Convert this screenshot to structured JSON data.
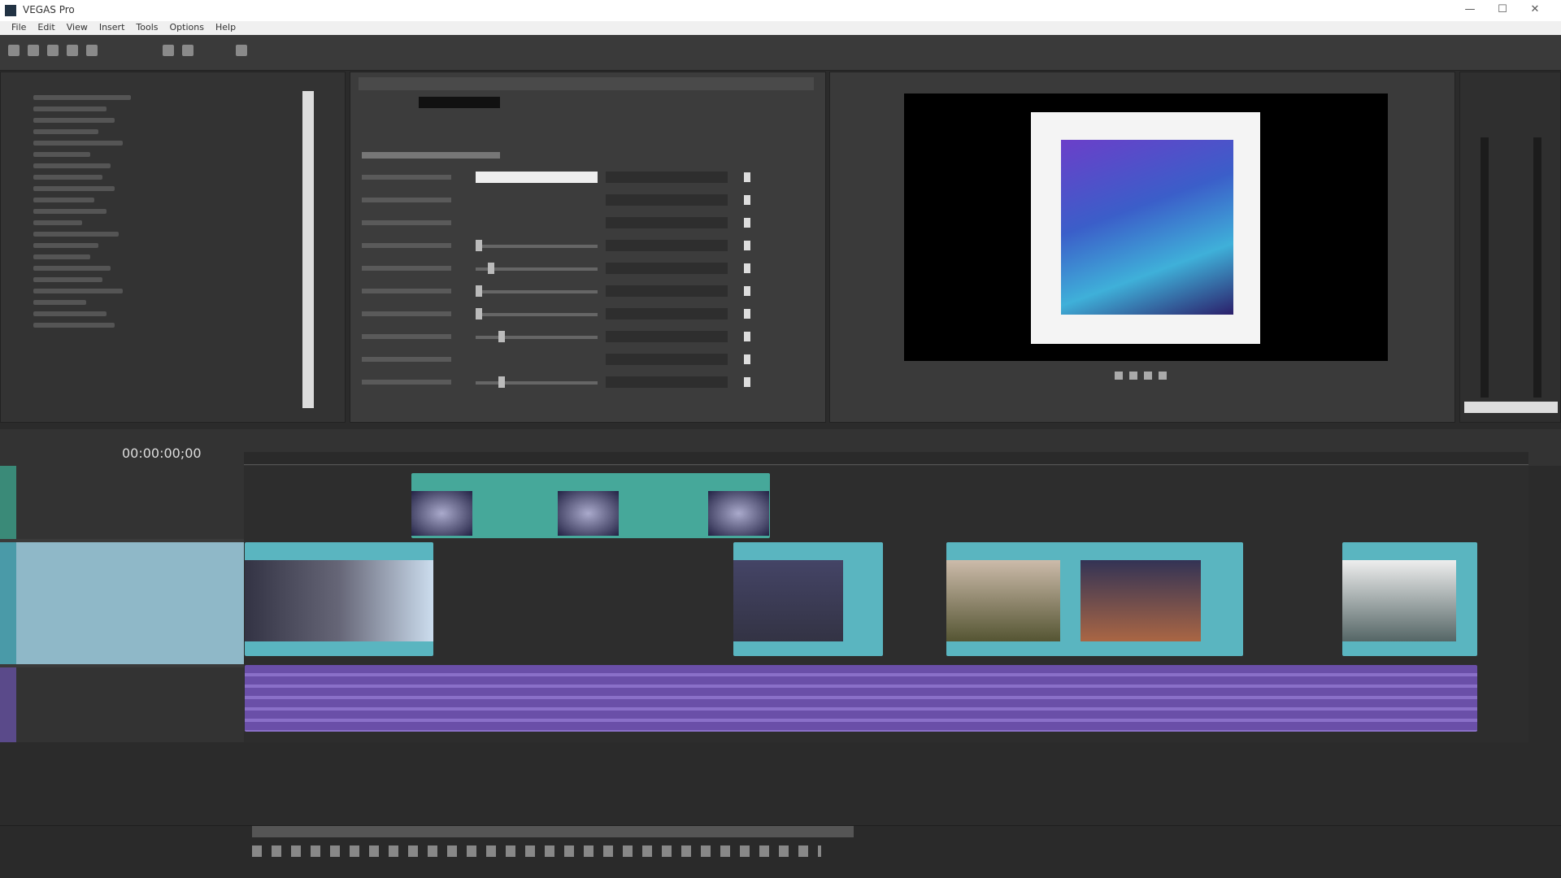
{
  "window": {
    "title": "VEGAS Pro",
    "minimize": "—",
    "maximize": "☐",
    "close": "✕"
  },
  "menu": [
    "File",
    "Edit",
    "View",
    "Insert",
    "Tools",
    "Options",
    "Help"
  ],
  "timeline": {
    "timecode": "00:00:00;00"
  },
  "colors": {
    "overlay_clip": "#46a89a",
    "video_clip": "#5ab5c0",
    "audio_clip": "#6a4fa8",
    "background": "#2b2b2b"
  }
}
